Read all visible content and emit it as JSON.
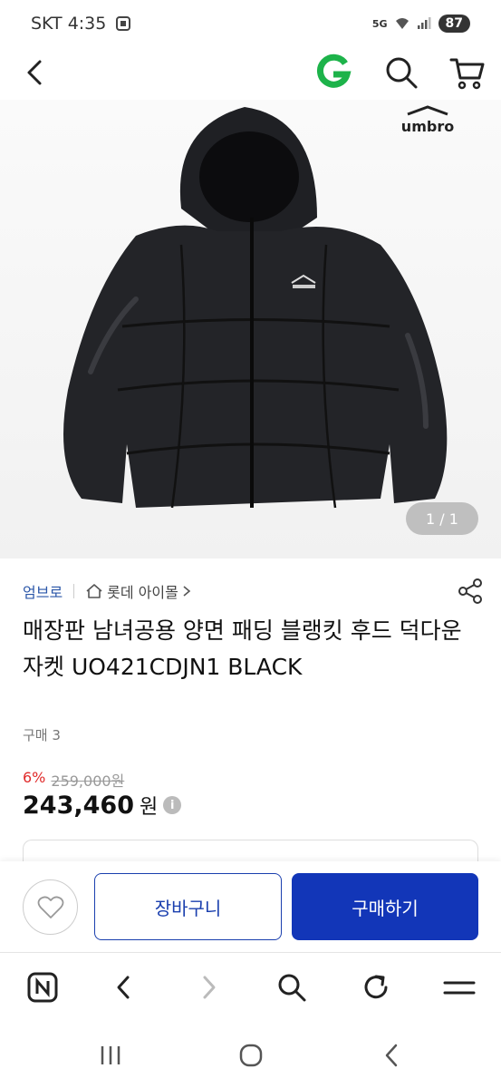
{
  "status_bar": {
    "carrier_time": "SKT 4:35",
    "network": "5G",
    "battery": "87"
  },
  "header": {
    "back_icon": "chevron-left-icon",
    "logo_icon": "g-logo-icon",
    "search_icon": "search-icon",
    "cart_icon": "cart-icon",
    "logo_color": "#1db34a"
  },
  "product_image": {
    "brand_logo_text": "umbro",
    "counter": "1 / 1"
  },
  "product": {
    "brand": "엄브로",
    "store": "롯데 아이몰",
    "title": "매장판 남녀공용 양면 패딩 블랭킷 후드 덕다운 자켓 UO421CDJN1 BLACK",
    "purchase_count": "구매 3",
    "discount_rate": "6%",
    "original_price": "259,000원",
    "sale_price": "243,460",
    "price_unit": "원",
    "info_icon_glyph": "i"
  },
  "purchase_bar": {
    "wish_icon": "heart-icon",
    "cart_button": "장바구니",
    "buy_button": "구매하기",
    "buy_color": "#1236b8"
  },
  "browser_nav": {
    "items": [
      "naver-icon",
      "back-icon",
      "forward-icon",
      "search-icon",
      "refresh-icon",
      "menu-icon"
    ]
  },
  "system_nav": {
    "items": [
      "recent-apps-icon",
      "home-icon",
      "back-icon"
    ]
  }
}
